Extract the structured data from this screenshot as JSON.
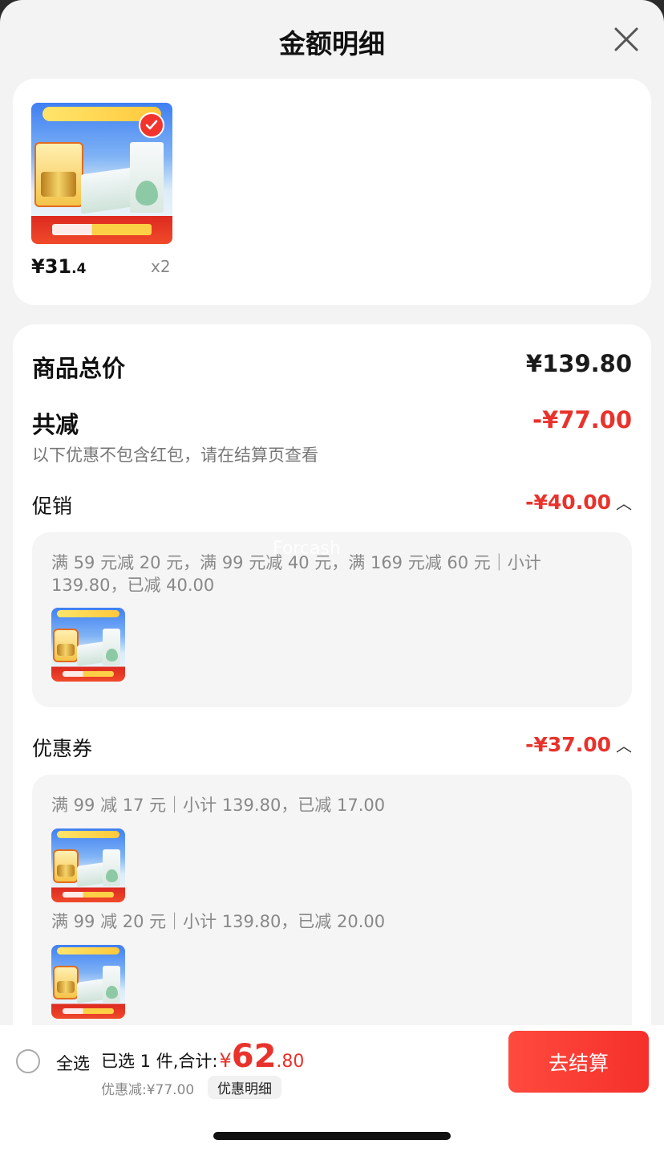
{
  "header": {
    "title": "金额明细"
  },
  "product": {
    "price_int": "¥31",
    "price_dec": ".4",
    "qty": "x2"
  },
  "detail": {
    "total_label": "商品总价",
    "total_value": "¥139.80",
    "reduce_label": "共减",
    "reduce_value": "-¥77.00",
    "reduce_note": "以下优惠不包含红包，请在结算页查看",
    "promo": {
      "label": "促销",
      "value": "-¥40.00",
      "rule_line1": "满 59 元减 20 元，满 99 元减 40 元，满 169 元减 60 元｜小计",
      "rule_line2": "139.80，已减 40.00"
    },
    "coupon": {
      "label": "优惠券",
      "value": "-¥37.00",
      "rule1": "满 99 减 17 元｜小计 139.80，已减 17.00",
      "rule2": "满 99 减 20 元｜小计 139.80，已减 20.00"
    }
  },
  "watermark": "Forcash",
  "footer": {
    "select_all": "全选",
    "summary_prefix": "已选 1 件,合计:",
    "currency": "¥",
    "total_int": "62",
    "total_dec": ".80",
    "discount": "优惠减:¥77.00",
    "detail_chip": "优惠明细",
    "checkout": "去结算"
  },
  "colors": {
    "accent": "#e8322b",
    "checkout": "#f5302b"
  },
  "icons": {
    "close": "close-icon",
    "check": "check-icon",
    "chevron": "chevron-up-icon"
  }
}
